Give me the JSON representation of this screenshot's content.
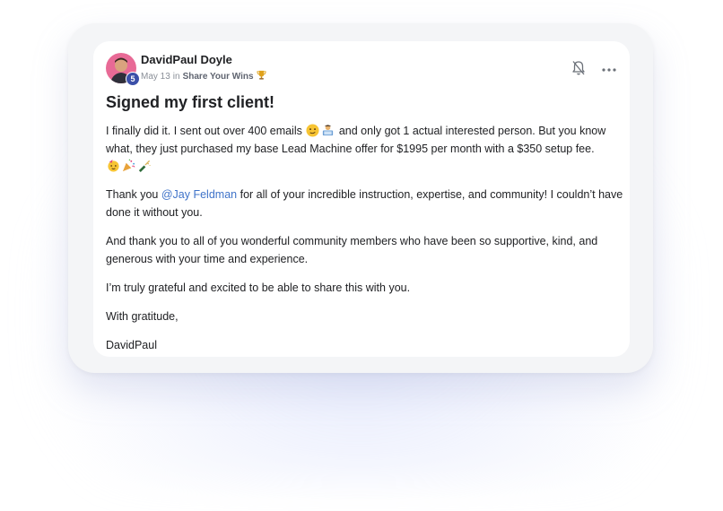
{
  "post": {
    "author": {
      "name": "DavidPaul Doyle",
      "level": "5"
    },
    "date": "May 13",
    "in_label": "in",
    "category": "Share Your Wins",
    "title": "Signed my first client!",
    "paragraphs": {
      "p1_a": "I finally did it. I sent out over 400 emails",
      "p1_b": "and only got 1 actual interested person. But you know what, they just purchased my base Lead Machine offer for $1995 per month with a $350 setup fee.",
      "p2_a": "Thank you",
      "p2_mention": "@Jay Feldman",
      "p2_b": "for all of your incredible instruction, expertise, and community! I couldn’t have done it without you.",
      "p3": "And thank you to all of you wonderful community members who have been so supportive, kind, and generous with your time and experience.",
      "p4": "I’m truly grateful and excited to be able to share this with you.",
      "p5": "With gratitude,",
      "p6": "DavidPaul"
    },
    "icons": {
      "bell": "bell-icon",
      "more": "more-icon",
      "trophy": "trophy-icon"
    }
  },
  "colors": {
    "mention": "#3f73c9",
    "level_badge": "#3b4fa8"
  }
}
